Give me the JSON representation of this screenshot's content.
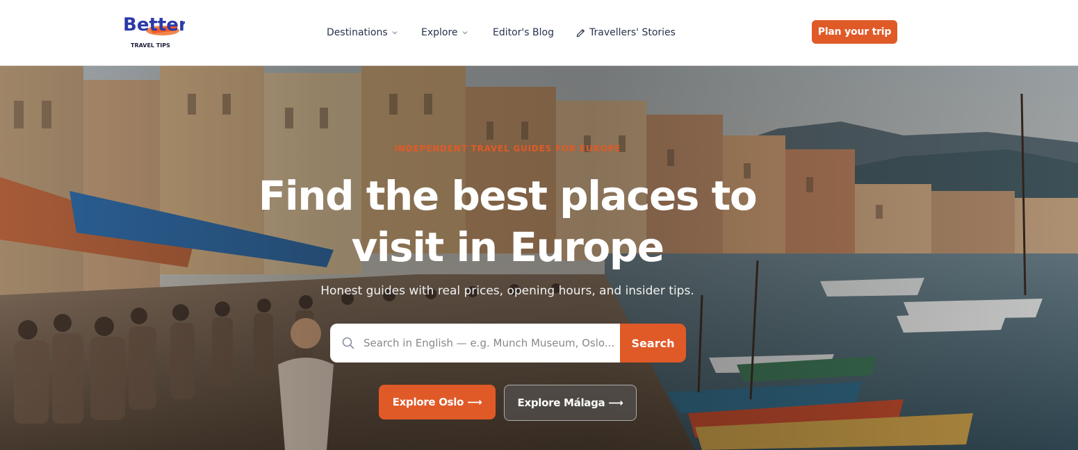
{
  "header": {
    "logo": {
      "word": "Better",
      "tagline": "TRAVEL TIPS"
    },
    "nav": [
      {
        "label": "Destinations",
        "has_dropdown": true
      },
      {
        "label": "Explore",
        "has_dropdown": true
      },
      {
        "label": "Editor's Blog",
        "has_dropdown": false
      },
      {
        "label": "Travellers' Stories",
        "icon": "pencil-icon"
      }
    ],
    "cta_label": "Plan your trip"
  },
  "hero": {
    "eyebrow": "INDEPENDENT TRAVEL GUIDES FOR EUROPE",
    "title_line1": "Find the best places to",
    "title_line2": "visit in Europe",
    "subtitle": "Honest guides with real prices, opening hours, and insider tips.",
    "search": {
      "placeholder": "Search in English — e.g. Munch Museum, Oslo...",
      "button": "Search",
      "icon": "search-icon"
    },
    "buttons": [
      {
        "label": "Explore Oslo ⟶"
      },
      {
        "label": "Explore Málaga ⟶"
      }
    ]
  },
  "colors": {
    "accent": "#e05a28",
    "nav_text": "#27324a",
    "logo_blue": "#2b3aa8"
  }
}
